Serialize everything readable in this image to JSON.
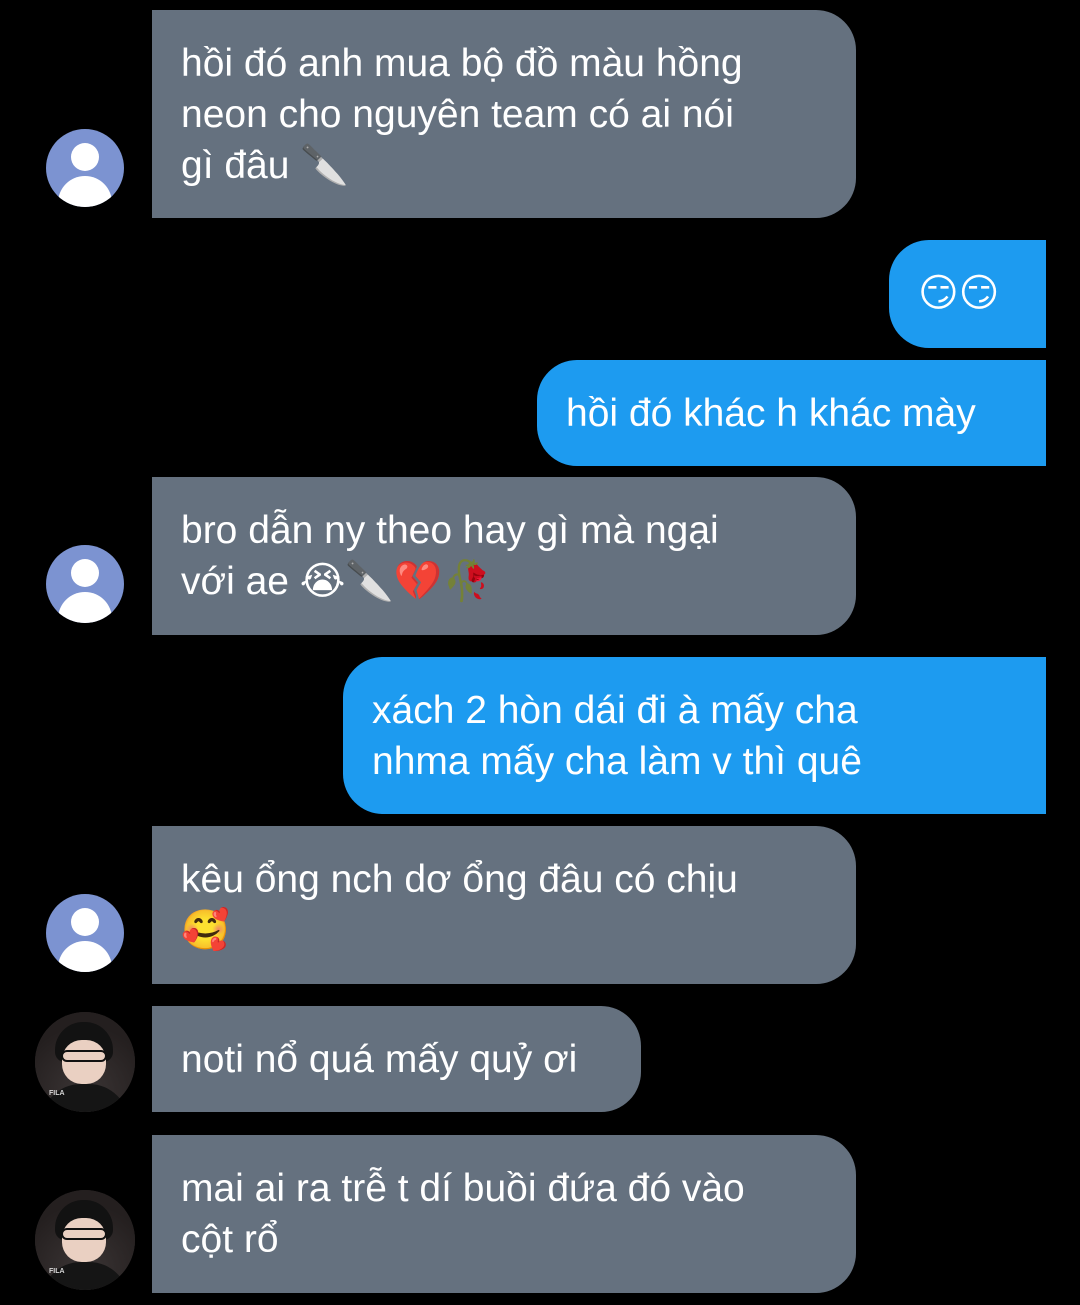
{
  "messages": [
    {
      "side": "in",
      "text": "hồi đó anh mua bộ đồ màu hồng\nneon cho nguyên team có ai nói\ngì đâu 🔪"
    },
    {
      "side": "out",
      "text": "😏😏"
    },
    {
      "side": "out",
      "text": "hồi đó khác h khác mày"
    },
    {
      "side": "in",
      "text": "bro dẫn ny theo hay gì mà ngại\nvới ae 😭🔪💔🥀"
    },
    {
      "side": "out",
      "text": "xách 2 hòn dái đi à mấy cha\nnhma mấy cha làm v thì quê"
    },
    {
      "side": "in",
      "text": "kêu ổng nch dơ ổng đâu có chịu\n🥰"
    },
    {
      "side": "in",
      "text": "noti nổ quá mấy quỷ ơi"
    },
    {
      "side": "in",
      "text": "mai ai ra trễ t dí buồi đứa đó vào\ncột rổ"
    }
  ],
  "avatar_photo_mark": "FILA",
  "colors": {
    "background": "#000000",
    "incoming_bubble": "#65717f",
    "outgoing_bubble": "#1d9bf0",
    "text": "#ffffff",
    "default_avatar": "#7c93d1"
  },
  "icons": {
    "default_avatar": "default-user-avatar-icon"
  }
}
